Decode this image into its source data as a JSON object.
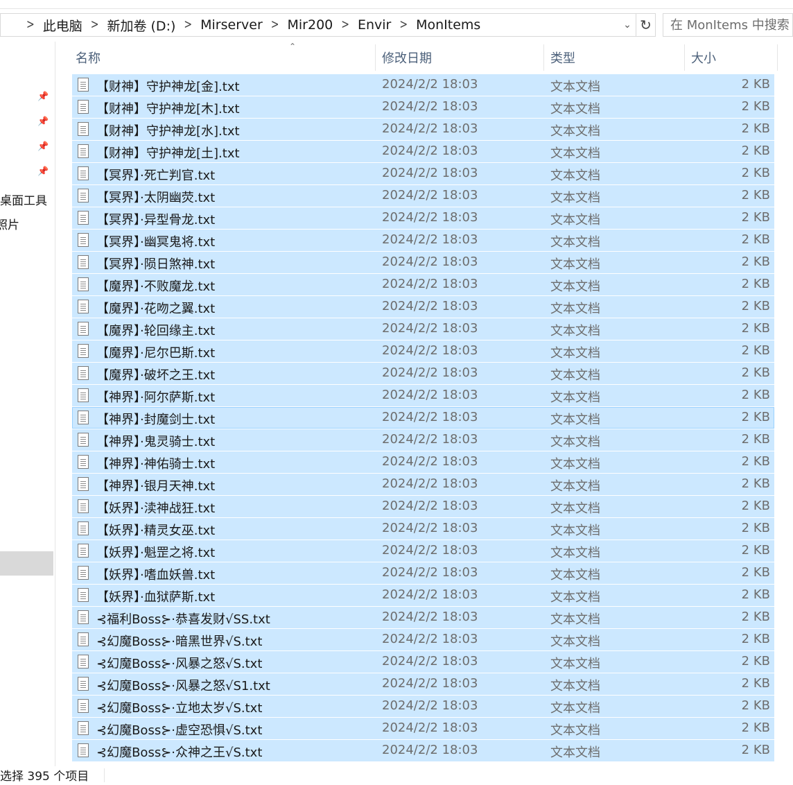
{
  "address": {
    "breadcrumbs": [
      "此电脑",
      "新加卷 (D:)",
      "Mirserver",
      "Mir200",
      "Envir",
      "MonItems"
    ],
    "dropdown_icon": "chevron-down-icon",
    "refresh_icon": "refresh-icon"
  },
  "search": {
    "placeholder": "在 MonItems 中搜索"
  },
  "nav": {
    "items": [
      {
        "label": "桌面工具"
      },
      {
        "label": "照片"
      }
    ]
  },
  "columns": {
    "name": "名称",
    "date": "修改日期",
    "type": "类型",
    "size": "大小"
  },
  "files": [
    {
      "name": "【财神】守护神龙[金].txt",
      "date": "2024/2/2 18:03",
      "type": "文本文档",
      "size": "2 KB"
    },
    {
      "name": "【财神】守护神龙[木].txt",
      "date": "2024/2/2 18:03",
      "type": "文本文档",
      "size": "2 KB"
    },
    {
      "name": "【财神】守护神龙[水].txt",
      "date": "2024/2/2 18:03",
      "type": "文本文档",
      "size": "2 KB"
    },
    {
      "name": "【财神】守护神龙[土].txt",
      "date": "2024/2/2 18:03",
      "type": "文本文档",
      "size": "2 KB"
    },
    {
      "name": "【冥界】·死亡判官.txt",
      "date": "2024/2/2 18:03",
      "type": "文本文档",
      "size": "2 KB"
    },
    {
      "name": "【冥界】·太阴幽荧.txt",
      "date": "2024/2/2 18:03",
      "type": "文本文档",
      "size": "2 KB"
    },
    {
      "name": "【冥界】·异型骨龙.txt",
      "date": "2024/2/2 18:03",
      "type": "文本文档",
      "size": "2 KB"
    },
    {
      "name": "【冥界】·幽冥鬼将.txt",
      "date": "2024/2/2 18:03",
      "type": "文本文档",
      "size": "2 KB"
    },
    {
      "name": "【冥界】·陨日煞神.txt",
      "date": "2024/2/2 18:03",
      "type": "文本文档",
      "size": "2 KB"
    },
    {
      "name": "【魔界】·不败魔龙.txt",
      "date": "2024/2/2 18:03",
      "type": "文本文档",
      "size": "2 KB"
    },
    {
      "name": "【魔界】·花吻之翼.txt",
      "date": "2024/2/2 18:03",
      "type": "文本文档",
      "size": "2 KB"
    },
    {
      "name": "【魔界】·轮回缘主.txt",
      "date": "2024/2/2 18:03",
      "type": "文本文档",
      "size": "2 KB"
    },
    {
      "name": "【魔界】·尼尔巴斯.txt",
      "date": "2024/2/2 18:03",
      "type": "文本文档",
      "size": "2 KB"
    },
    {
      "name": "【魔界】·破坏之王.txt",
      "date": "2024/2/2 18:03",
      "type": "文本文档",
      "size": "2 KB"
    },
    {
      "name": "【神界】·阿尔萨斯.txt",
      "date": "2024/2/2 18:03",
      "type": "文本文档",
      "size": "2 KB"
    },
    {
      "name": "【神界】·封魔剑士.txt",
      "date": "2024/2/2 18:03",
      "type": "文本文档",
      "size": "2 KB"
    },
    {
      "name": "【神界】·鬼灵骑士.txt",
      "date": "2024/2/2 18:03",
      "type": "文本文档",
      "size": "2 KB"
    },
    {
      "name": "【神界】·神佑骑士.txt",
      "date": "2024/2/2 18:03",
      "type": "文本文档",
      "size": "2 KB"
    },
    {
      "name": "【神界】·银月天神.txt",
      "date": "2024/2/2 18:03",
      "type": "文本文档",
      "size": "2 KB"
    },
    {
      "name": "【妖界】·渎神战狂.txt",
      "date": "2024/2/2 18:03",
      "type": "文本文档",
      "size": "2 KB"
    },
    {
      "name": "【妖界】·精灵女巫.txt",
      "date": "2024/2/2 18:03",
      "type": "文本文档",
      "size": "2 KB"
    },
    {
      "name": "【妖界】·魁罡之将.txt",
      "date": "2024/2/2 18:03",
      "type": "文本文档",
      "size": "2 KB"
    },
    {
      "name": "【妖界】·嗜血妖兽.txt",
      "date": "2024/2/2 18:03",
      "type": "文本文档",
      "size": "2 KB"
    },
    {
      "name": "【妖界】·血狱萨斯.txt",
      "date": "2024/2/2 18:03",
      "type": "文本文档",
      "size": "2 KB"
    },
    {
      "name": "⊰福利Boss⊱·恭喜发财√SS.txt",
      "date": "2024/2/2 18:03",
      "type": "文本文档",
      "size": "2 KB"
    },
    {
      "name": "⊰幻魔Boss⊱·暗黑世界√S.txt",
      "date": "2024/2/2 18:03",
      "type": "文本文档",
      "size": "2 KB"
    },
    {
      "name": "⊰幻魔Boss⊱·风暴之怒√S.txt",
      "date": "2024/2/2 18:03",
      "type": "文本文档",
      "size": "2 KB"
    },
    {
      "name": "⊰幻魔Boss⊱·风暴之怒√S1.txt",
      "date": "2024/2/2 18:03",
      "type": "文本文档",
      "size": "2 KB"
    },
    {
      "name": "⊰幻魔Boss⊱·立地太岁√S.txt",
      "date": "2024/2/2 18:03",
      "type": "文本文档",
      "size": "2 KB"
    },
    {
      "name": "⊰幻魔Boss⊱·虚空恐惧√S.txt",
      "date": "2024/2/2 18:03",
      "type": "文本文档",
      "size": "2 KB"
    },
    {
      "name": "⊰幻魔Boss⊱·众神之王√S.txt",
      "date": "2024/2/2 18:03",
      "type": "文本文档",
      "size": "2 KB"
    }
  ],
  "focused_index": 15,
  "status": {
    "text": "选择 395 个项目"
  },
  "colors": {
    "selection": "#cce8ff",
    "focus_border": "#99d1ff",
    "header_text": "#4c607a"
  }
}
